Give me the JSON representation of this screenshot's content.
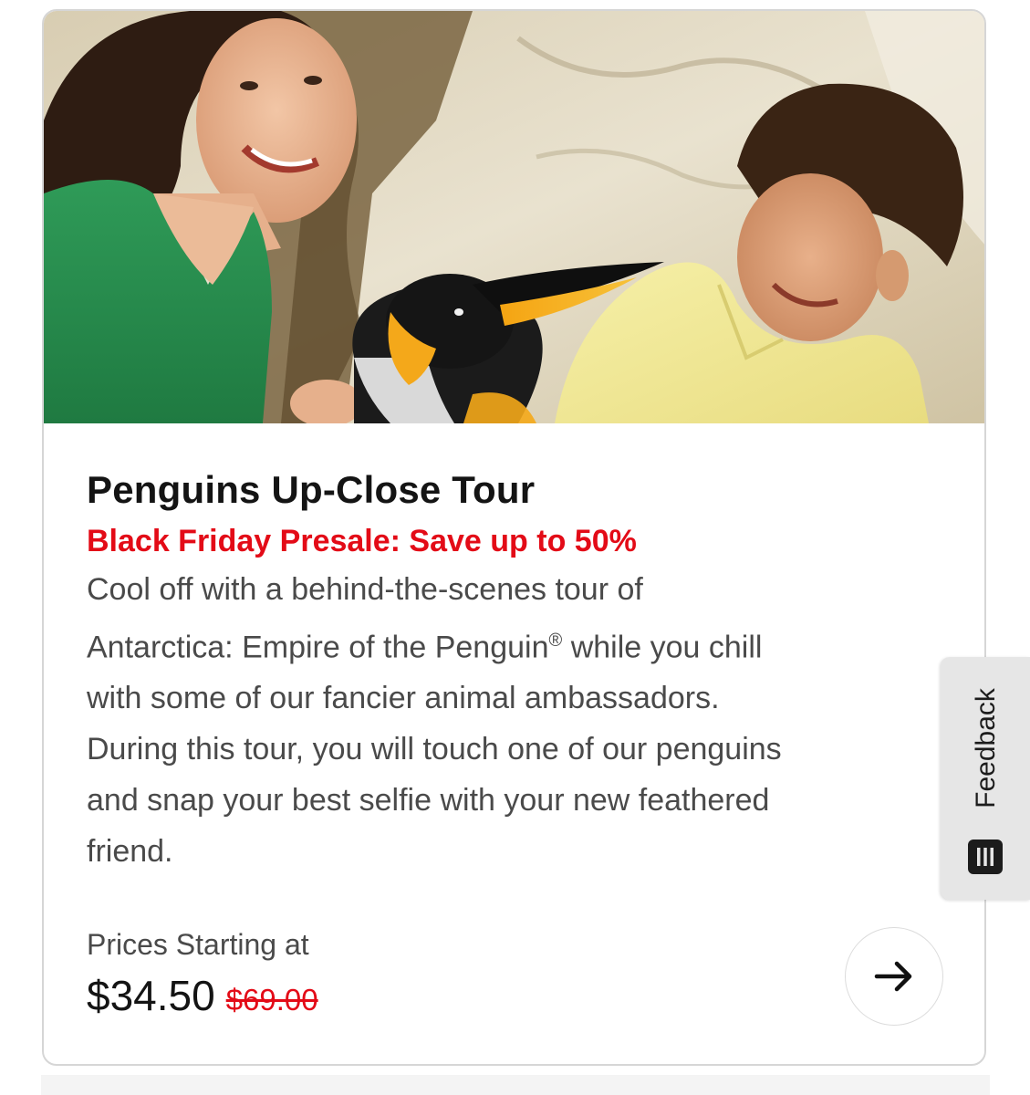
{
  "card": {
    "image_alt": "Woman and boy smiling at a king penguin",
    "title": "Penguins Up-Close Tour",
    "promo": "Black Friday Presale: Save up to 50%",
    "description_lines": [
      "Cool off with a behind-the-scenes tour of",
      "Antarctica: Empire of the Penguin",
      "®",
      " while you chill",
      "with some of our fancier animal ambassadors.",
      "During this tour, you will touch one of our penguins",
      "and snap your best selfie with your new feathered",
      "friend."
    ],
    "price_label": "Prices Starting at",
    "price_current": "$34.50",
    "price_original": "$69.00",
    "arrow_icon": "arrow-right-icon"
  },
  "feedback": {
    "label": "Feedback",
    "icon": "feedback-list-icon"
  },
  "colors": {
    "accent_red": "#e30b17",
    "title_text": "#141414",
    "body_text": "#4a4a4a",
    "card_border": "#d6d6d6",
    "feedback_bg": "#e6e6e6"
  }
}
